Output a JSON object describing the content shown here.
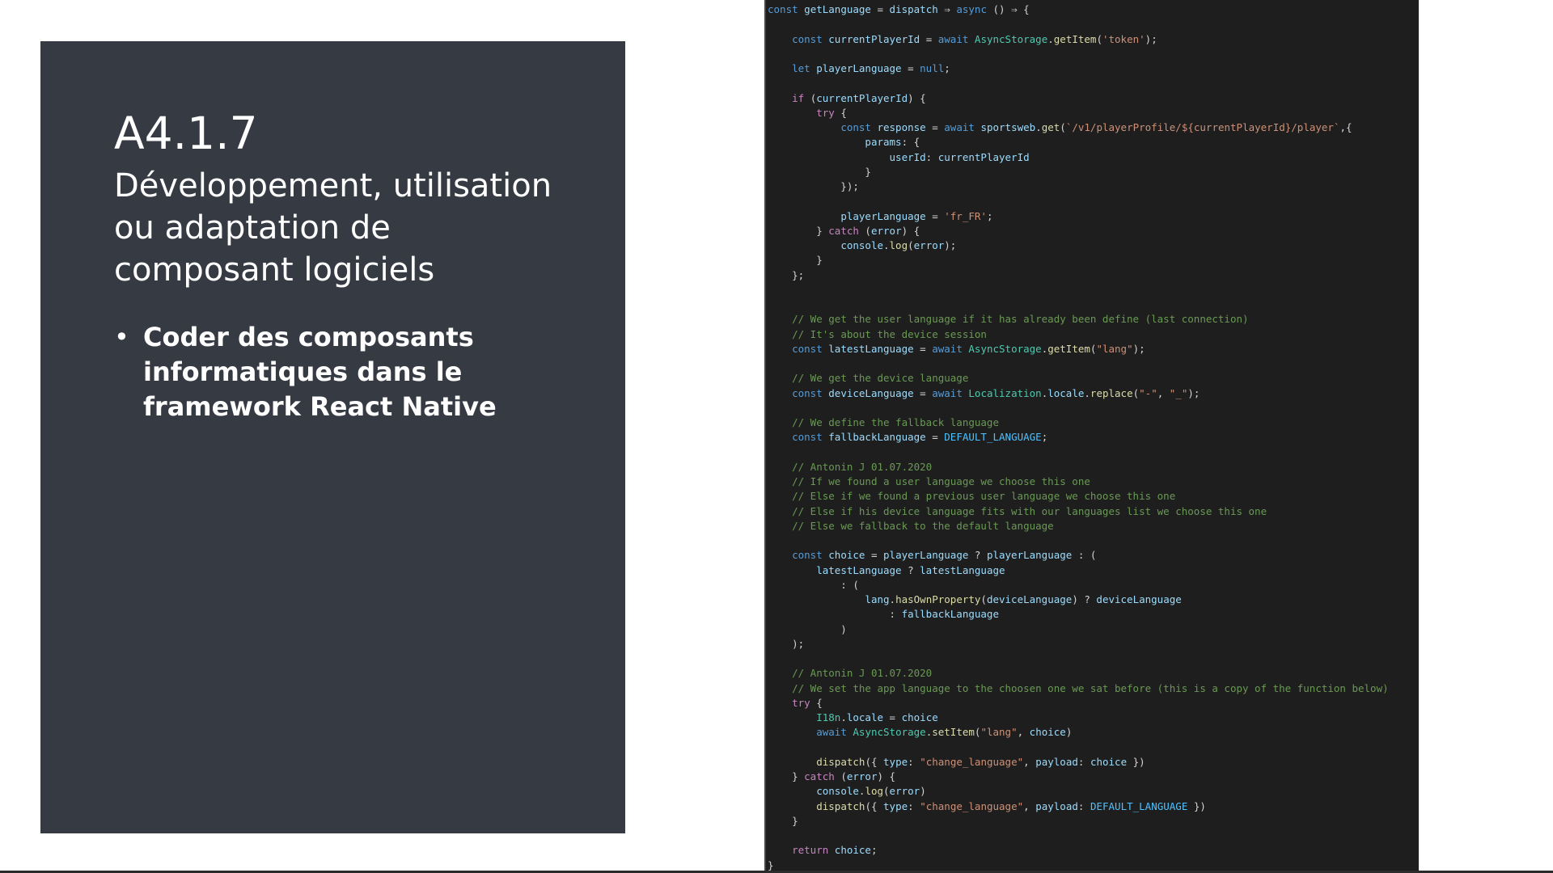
{
  "slide": {
    "code_label": "A4.1.7",
    "heading": "Développement, utilisation ou adaptation de composant logiciels",
    "bullet": "Coder des composants informatiques dans le framework React Native"
  },
  "colors": {
    "slide_background": "#353a43",
    "editor_background": "#1e1e1e",
    "keyword": "#569cd6",
    "control": "#c586c0",
    "variable": "#9cdcfe",
    "function": "#dcdcaa",
    "string": "#ce9178",
    "comment": "#6a9955",
    "constant": "#4fc1ff",
    "class": "#4ec9b0"
  },
  "code": {
    "lines": [
      "const getLanguage = dispatch ⇒ async () ⇒ {",
      "",
      "    const currentPlayerId = await AsyncStorage.getItem('token');",
      "",
      "    let playerLanguage = null;",
      "",
      "    if (currentPlayerId) {",
      "        try {",
      "            const response = await sportsweb.get(`/v1/playerProfile/${currentPlayerId}/player`,{",
      "                params: {",
      "                    userId: currentPlayerId",
      "                }",
      "            });",
      "",
      "            playerLanguage = 'fr_FR';",
      "        } catch (error) {",
      "            console.log(error);",
      "        }",
      "    };",
      "",
      "",
      "    // We get the user language if it has already been define (last connection)",
      "    // It's about the device session",
      "    const latestLanguage = await AsyncStorage.getItem(\"lang\");",
      "",
      "    // We get the device language",
      "    const deviceLanguage = await Localization.locale.replace(\"-\", \"_\");",
      "",
      "    // We define the fallback language",
      "    const fallbackLanguage = DEFAULT_LANGUAGE;",
      "",
      "    // Antonin J 01.07.2020",
      "    // If we found a user language we choose this one",
      "    // Else if we found a previous user language we choose this one",
      "    // Else if his device language fits with our languages list we choose this one",
      "    // Else we fallback to the default language",
      "",
      "    const choice = playerLanguage ? playerLanguage : (",
      "        latestLanguage ? latestLanguage",
      "            : (",
      "                lang.hasOwnProperty(deviceLanguage) ? deviceLanguage",
      "                    : fallbackLanguage",
      "            )",
      "    );",
      "",
      "    // Antonin J 01.07.2020",
      "    // We set the app language to the choosen one we sat before (this is a copy of the function below)",
      "    try {",
      "        I18n.locale = choice",
      "        await AsyncStorage.setItem(\"lang\", choice)",
      "",
      "        dispatch({ type: \"change_language\", payload: choice })",
      "    } catch (error) {",
      "        console.log(error)",
      "        dispatch({ type: \"change_language\", payload: DEFAULT_LANGUAGE })",
      "    }",
      "",
      "    return choice;",
      "}"
    ]
  }
}
